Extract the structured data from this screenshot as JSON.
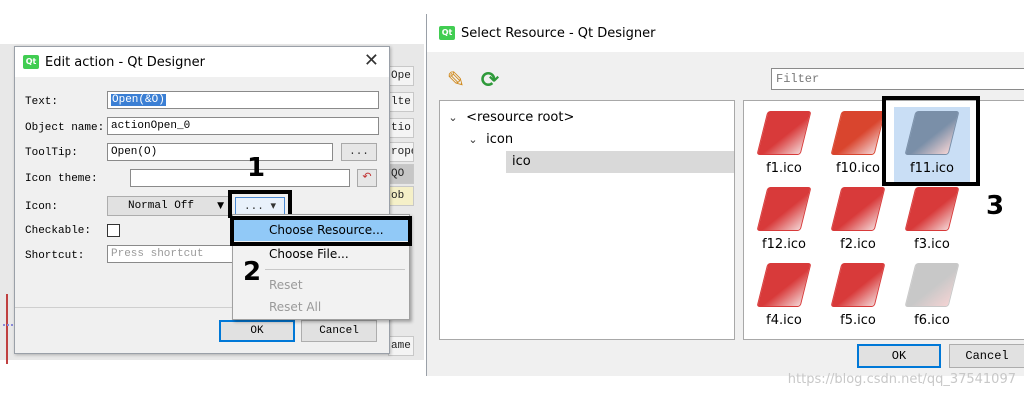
{
  "background_window": {
    "stripes": [
      {
        "text": "Ope",
        "top": 0
      },
      {
        "text": "lte",
        "top": 0
      },
      {
        "text": "tio",
        "top": 0
      },
      {
        "text": "rope",
        "top": 0
      },
      {
        "text": "QO",
        "top": 0
      },
      {
        "text": "ob",
        "top": 0
      },
      {
        "text": "ame",
        "top": 0
      }
    ]
  },
  "edit_action": {
    "title": "Edit action - Qt Designer",
    "app_logo": "Qt",
    "close_glyph": "✕",
    "labels": {
      "text": "Text:",
      "object_name": "Object name:",
      "tooltip": "ToolTip:",
      "icon_theme": "Icon theme:",
      "icon": "Icon:",
      "checkable": "Checkable:",
      "shortcut": "Shortcut:"
    },
    "values": {
      "text": "Open(&O)",
      "object_name": "actionOpen_0",
      "tooltip": "Open(O)",
      "icon_theme": "",
      "icon_mode": "Normal Off",
      "shortcut_placeholder": "Press shortcut"
    },
    "buttons": {
      "tooltip_more": "...",
      "icon_theme_reset": "↶",
      "icon_more": "...",
      "icon_more_arrow": "▾",
      "combo_arrow": "▼",
      "ok": "OK",
      "cancel": "Cancel"
    },
    "menu": {
      "items": [
        {
          "label": "Choose Resource...",
          "state": "highlighted"
        },
        {
          "label": "Choose File...",
          "state": "normal"
        },
        {
          "label": "Reset",
          "state": "disabled"
        },
        {
          "label": "Reset All",
          "state": "disabled"
        }
      ]
    },
    "annotations": [
      "1",
      "2"
    ]
  },
  "select_resource": {
    "title": "Select Resource - Qt Designer",
    "app_logo": "Qt",
    "tools": {
      "edit_icon": "pencil-icon",
      "reload_icon": "reload-icon",
      "pencil": "✎",
      "reload": "⟳"
    },
    "filter_placeholder": "Filter",
    "tree": [
      {
        "label": "<resource root>",
        "chevron": "⌄",
        "level": 0
      },
      {
        "label": "icon",
        "chevron": "⌄",
        "level": 1
      },
      {
        "label": "ico",
        "chevron": "",
        "level": 2,
        "selected": true
      }
    ],
    "resources": [
      {
        "label": "f1.ico",
        "color": "#d83a3a"
      },
      {
        "label": "f10.ico",
        "color": "#d9452e"
      },
      {
        "label": "f11.ico",
        "color": "#7a8fa8",
        "selected": true
      },
      {
        "label": "f12.ico",
        "color": "#d83a3a"
      },
      {
        "label": "f2.ico",
        "color": "#d83a3a"
      },
      {
        "label": "f3.ico",
        "color": "#d83a3a"
      },
      {
        "label": "f4.ico",
        "color": "#d83a3a"
      },
      {
        "label": "f5.ico",
        "color": "#d83a3a"
      },
      {
        "label": "f6.ico",
        "color": "#c8c8c8"
      }
    ],
    "buttons": {
      "ok": "OK",
      "cancel": "Cancel"
    },
    "annotation": "3",
    "watermark": "https://blog.csdn.net/qq_37541097"
  }
}
